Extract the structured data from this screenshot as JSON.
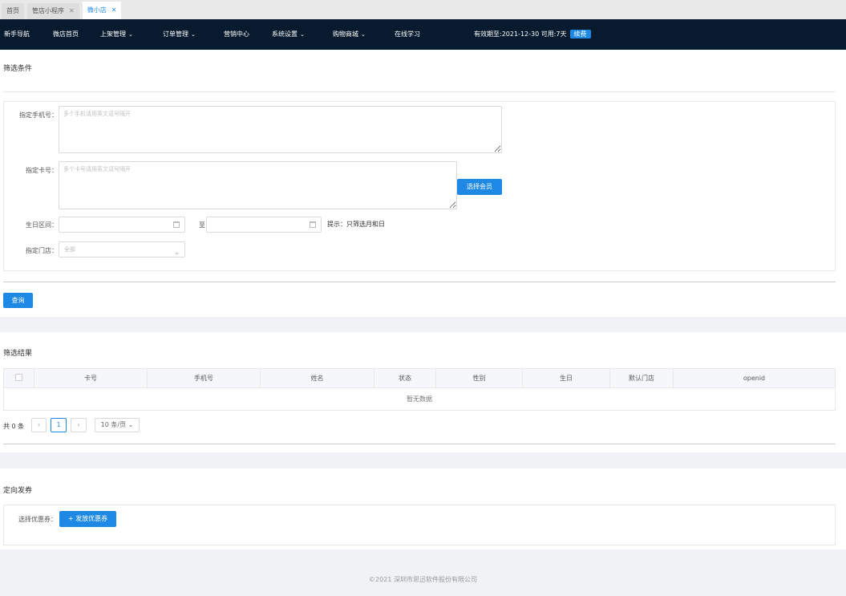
{
  "tabs": [
    {
      "label": "首页",
      "closable": false
    },
    {
      "label": "管店小程序",
      "closable": true
    },
    {
      "label": "微小店",
      "closable": true
    }
  ],
  "nav": {
    "items": [
      "新手导航",
      "微店首页",
      "上架管理",
      "订单管理",
      "营销中心",
      "系统设置",
      "购物商城",
      "在线学习"
    ],
    "expiry": "有效期至:2021-12-30  可用:7天",
    "renew": "续费"
  },
  "filter": {
    "title": "筛选条件",
    "phone_label": "指定手机号：",
    "phone_placeholder": "多个手机请用英文逗号隔开",
    "card_label": "指定卡号：",
    "card_placeholder": "多个卡号请用英文逗号隔开",
    "select_member": "选择会员",
    "birthday_label": "生日区间：",
    "to_label": "至",
    "hint": "提示：只筛选月和日",
    "store_label": "指定门店：",
    "store_value": "全部",
    "query": "查询"
  },
  "results": {
    "title": "筛选结果",
    "columns": [
      "卡号",
      "手机号",
      "姓名",
      "状态",
      "性别",
      "生日",
      "默认门店",
      "openid"
    ],
    "empty": "暂无数据",
    "total": "共 0 条",
    "page": "1",
    "page_size": "10 条/页"
  },
  "coupon": {
    "title": "定向发券",
    "label": "选择优惠券：",
    "button": "+ 发放优惠券"
  },
  "footer": "©2021 深圳市思迅软件股份有限公司",
  "colors": {
    "nav_bg": "#071a2e",
    "accent": "#1e88e5"
  }
}
